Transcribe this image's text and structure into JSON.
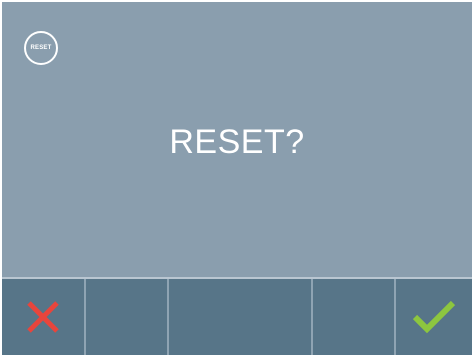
{
  "screen": {
    "badge_label": "RESET",
    "title": "RESET?"
  },
  "bottom_bar": {
    "cancel": {
      "icon": "cross-icon",
      "color": "#e8453c"
    },
    "confirm": {
      "icon": "checkmark-icon",
      "color": "#8dc63f"
    }
  },
  "colors": {
    "background": "#8a9eae",
    "bottom_bar": "#577588",
    "text": "#ffffff"
  }
}
